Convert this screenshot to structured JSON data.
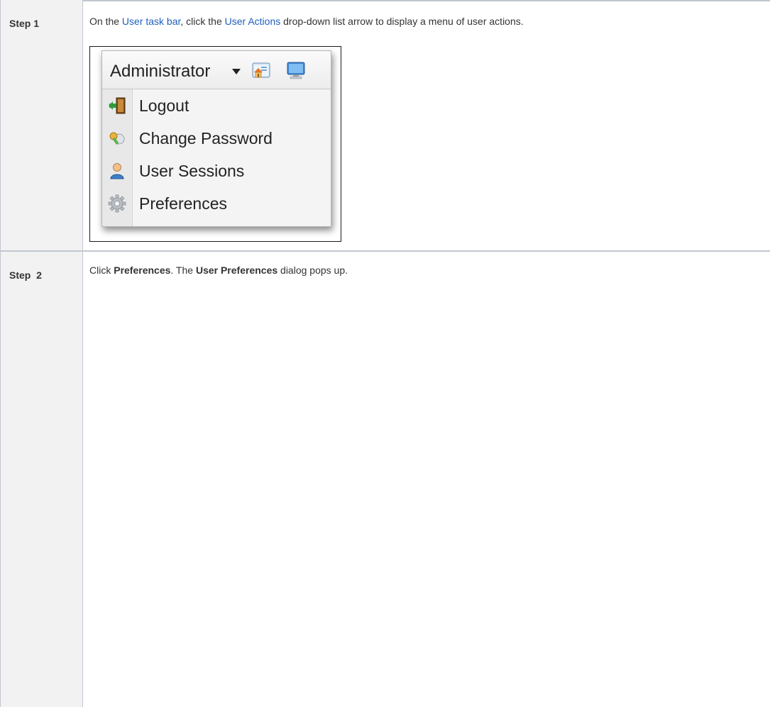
{
  "steps": [
    {
      "label": "Step 1",
      "instruction": {
        "prefix": "On the ",
        "link1": "User task bar",
        "mid": ", click the ",
        "link2": "User Actions",
        "suffix": " drop-down list arrow to display a menu of user actions."
      },
      "screenshot": {
        "header_label": "Administrator",
        "icons": [
          "caret-down-icon",
          "home-icon",
          "monitor-icon"
        ],
        "menu_items": [
          {
            "label": "Logout",
            "icon": "logout-door-icon"
          },
          {
            "label": "Change Password",
            "icon": "key-icon"
          },
          {
            "label": "User Sessions",
            "icon": "user-icon"
          },
          {
            "label": "Preferences",
            "icon": "gear-icon"
          }
        ]
      }
    },
    {
      "label": "Step  2",
      "instruction": {
        "prefix": "Click ",
        "bold1": "Preferences",
        "mid": ". The ",
        "bold2": "User Preferences",
        "suffix": " dialog pops up."
      }
    }
  ],
  "colors": {
    "link": "#1f5fbf",
    "header_cell_bg": "#f2f2f2",
    "border": "#c1c7d0"
  }
}
